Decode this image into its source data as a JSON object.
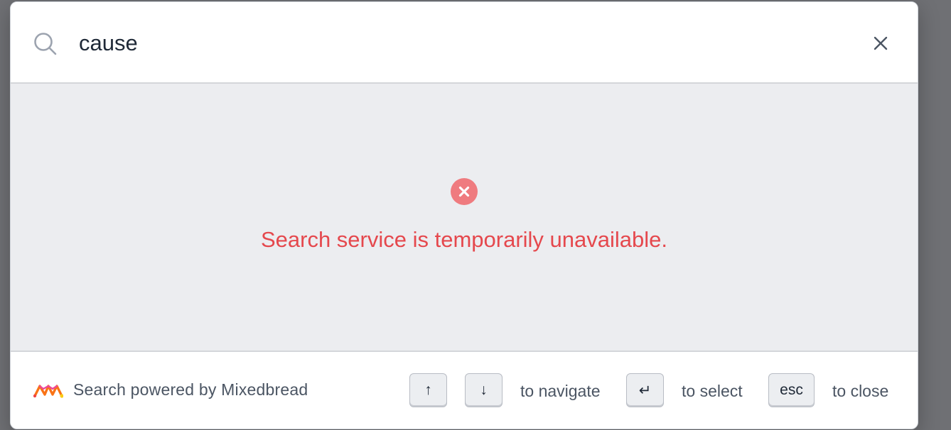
{
  "search": {
    "query": "cause"
  },
  "error": {
    "message": "Search service is temporarily unavailable."
  },
  "footer": {
    "powered_by": "Search powered by Mixedbread",
    "keys": {
      "up": "↑",
      "down": "↓",
      "enter": "↵",
      "esc": "esc"
    },
    "hints": {
      "navigate": "to navigate",
      "select": "to select",
      "close": "to close"
    }
  },
  "colors": {
    "error": "#e5484d",
    "results_background": "#ecedf0",
    "brand_accent": "#f97316"
  }
}
